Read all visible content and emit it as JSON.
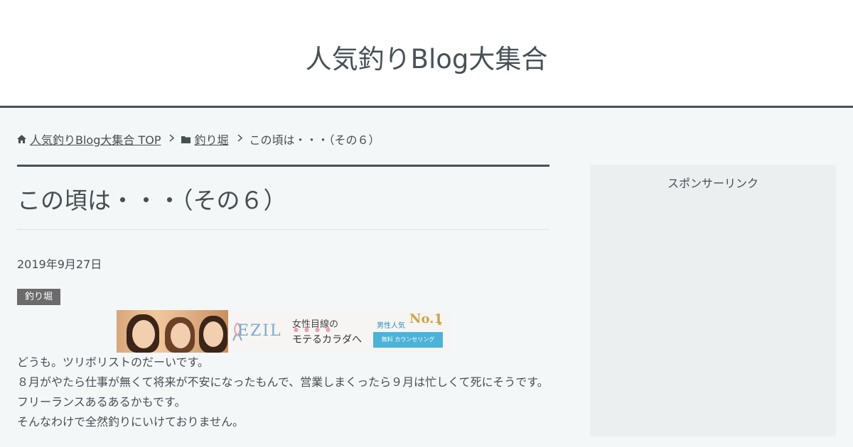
{
  "header": {
    "site_title": "人気釣りBlog大集合"
  },
  "breadcrumb": {
    "home_icon": "home-icon",
    "home_label": "人気釣りBlog大集合 TOP",
    "folder_icon": "folder-icon",
    "category_label": "釣り堀",
    "current_label": "この頃は・・・（その６）",
    "separator_icon": "chevron-right-icon"
  },
  "post": {
    "title": "この頃は・・・（その６）",
    "date": "2019年9月27日",
    "category_badge": "釣り堀",
    "paragraphs": [
      "どうも。ツリボリストのだーいです。",
      "８月がやたら仕事が無くて将来が不安になったもんで、営業しまくったら９月は忙しくて死にそうです。",
      "フリーランスあるあるかもです。",
      "そんなわけで全然釣りにいけておりません。"
    ]
  },
  "banner": {
    "logo": "EZIL",
    "copy_line1": "女性目線の",
    "copy_line2": "モテるカラダへ",
    "rank_label": "男性人気",
    "rank_value": "No.1",
    "button_label": "無料 カウンセリング",
    "colors": {
      "accent": "#4bb3d8",
      "gold": "#c9a646"
    }
  },
  "sidebar": {
    "sponsor_label": "スポンサーリンク"
  },
  "colors": {
    "header_border": "#475156",
    "background": "#f4f7f8",
    "text": "#464e52",
    "badge": "#6b6b6b"
  }
}
